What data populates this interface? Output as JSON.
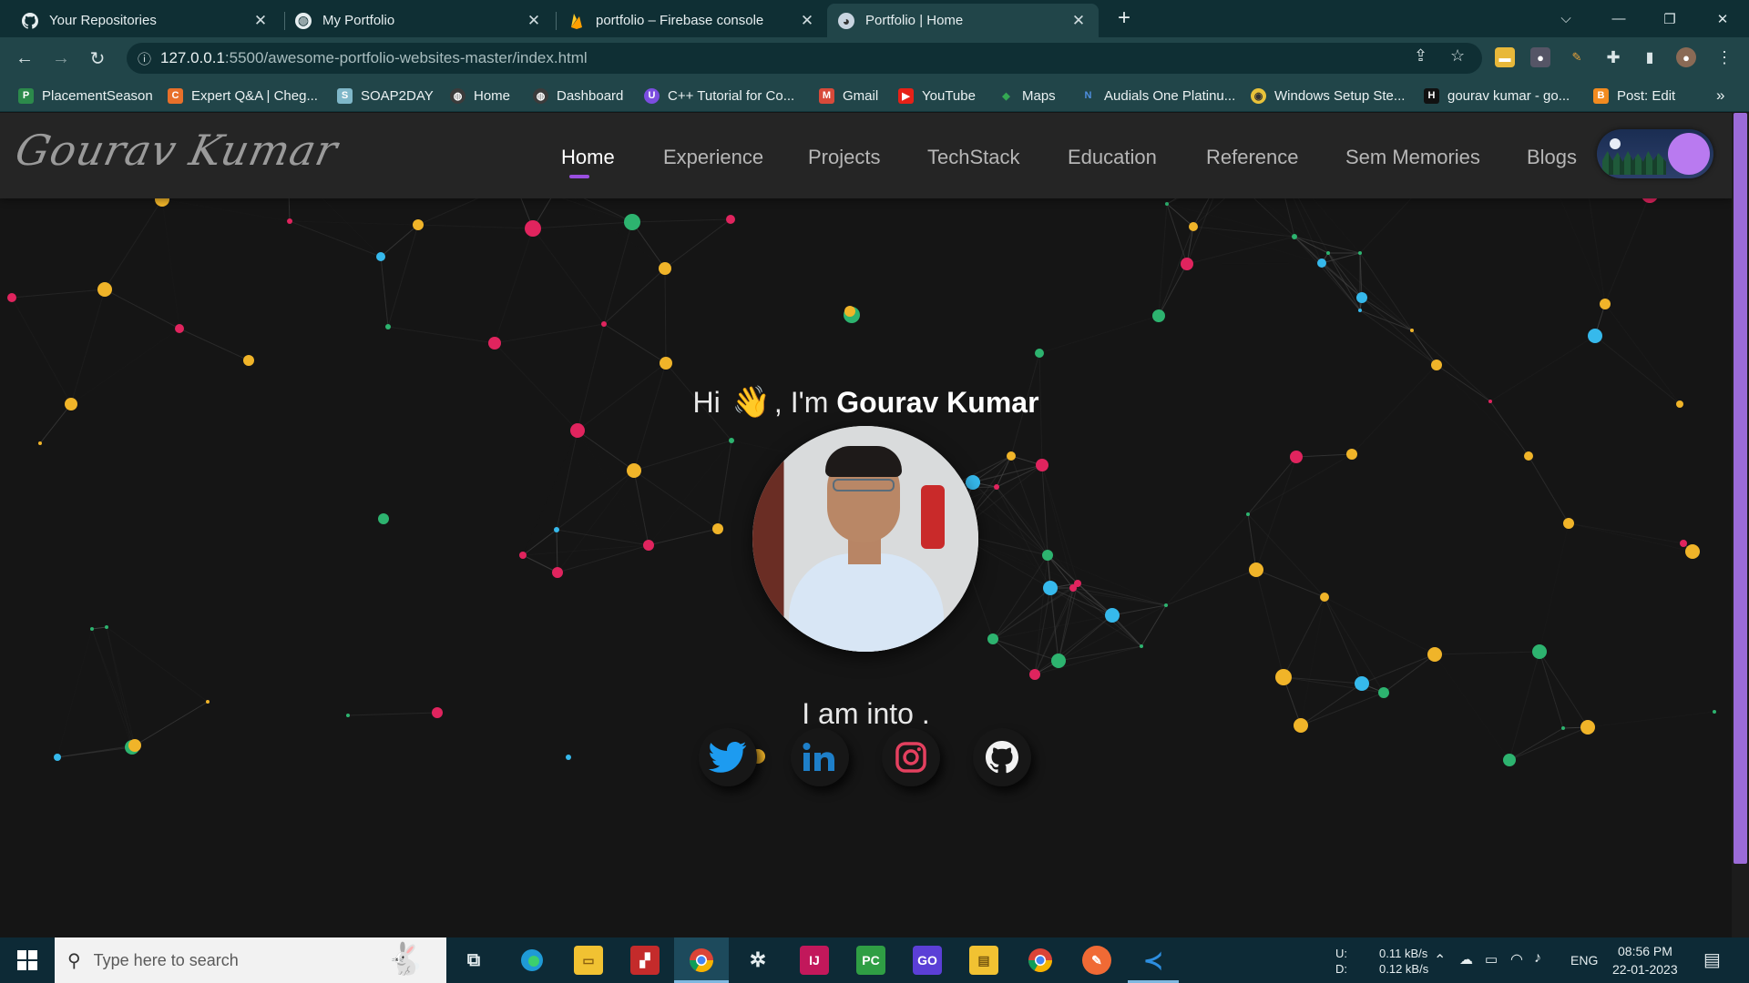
{
  "browser": {
    "tabs": [
      {
        "title": "Your Repositories",
        "icon": "github-icon"
      },
      {
        "title": "My Portfolio",
        "icon": "globe-icon"
      },
      {
        "title": "portfolio – Firebase console",
        "icon": "firebase-icon"
      },
      {
        "title": "Portfolio | Home",
        "icon": "portfolio-favicon",
        "active": true
      }
    ],
    "url_host": "127.0.0.1",
    "url_path": ":5500/awesome-portfolio-websites-master/index.html",
    "bookmarks": [
      {
        "label": "PlacementSeason",
        "icon_color": "#2c8a4b",
        "glyph": "P"
      },
      {
        "label": "Expert Q&A | Cheg...",
        "icon_color": "#e8702a",
        "glyph": "C"
      },
      {
        "label": "SOAP2DAY",
        "icon_color": "#7fb7c9",
        "glyph": "S"
      },
      {
        "label": "Home",
        "icon_color": "#3b3b3b",
        "glyph": "◍"
      },
      {
        "label": "Dashboard",
        "icon_color": "#3b3b3b",
        "glyph": "◍"
      },
      {
        "label": "C++ Tutorial for Co...",
        "icon_color": "#7b4de0",
        "glyph": "U"
      },
      {
        "label": "Gmail",
        "icon_color": "#d84a3a",
        "glyph": "M"
      },
      {
        "label": "YouTube",
        "icon_color": "#e62117",
        "glyph": "▶"
      },
      {
        "label": "Maps",
        "icon_color": "#34a853",
        "glyph": "◆"
      },
      {
        "label": "Audials One Platinu...",
        "icon_color": "#2f6fb8",
        "glyph": "N"
      },
      {
        "label": "Windows Setup Ste...",
        "icon_color": "#e8c23a",
        "glyph": "◉"
      },
      {
        "label": "gourav kumar - go...",
        "icon_color": "#111111",
        "glyph": "H"
      },
      {
        "label": "Post: Edit",
        "icon_color": "#f28b20",
        "glyph": "B"
      }
    ]
  },
  "site": {
    "logo": "Gourav Kumar",
    "nav": [
      "Home",
      "Experience",
      "Projects",
      "TechStack",
      "Education",
      "Reference",
      "Sem Memories",
      "Blogs"
    ],
    "greeting_prefix": "Hi",
    "greeting_wave": "👋",
    "greeting_mid": ", I'm",
    "name": "Gourav Kumar",
    "tagline": "I am into .",
    "socials": [
      "twitter",
      "linkedin",
      "instagram",
      "github"
    ]
  },
  "taskbar": {
    "search_placeholder": "Type here to search",
    "net_up_label": "U:",
    "net_down_label": "D:",
    "net_up": "0.11 kB/s",
    "net_down": "0.12 kB/s",
    "lang": "ENG",
    "time": "08:56 PM",
    "date": "22-01-2023"
  },
  "colors": {
    "accent_purple": "#9a4fe0",
    "dot_yellow": "#f0b429",
    "dot_blue": "#36b9ec",
    "dot_red": "#e0245e",
    "dot_green": "#2db36f"
  }
}
